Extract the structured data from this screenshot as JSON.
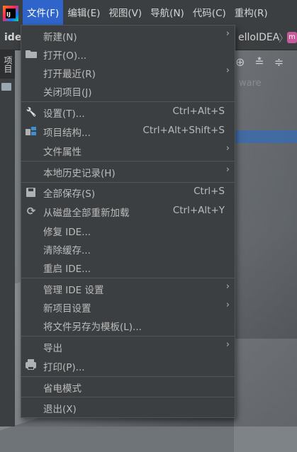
{
  "menubar": {
    "logo_text": "IJ",
    "items": [
      "文件(F)",
      "编辑(E)",
      "视图(V)",
      "导航(N)",
      "代码(C)",
      "重构(R)"
    ]
  },
  "navbar": {
    "project_name": "ide",
    "file_name": "elloIDEA",
    "chevron": "〉",
    "file_badge": "m"
  },
  "toolstrip": {
    "project_tab": "项目"
  },
  "background_text": {
    "ware": "ware"
  },
  "toolbar_icons": [
    "⊕",
    "≛",
    "≑"
  ],
  "menu": {
    "items": [
      {
        "label": "新建(N)",
        "shortcut": "",
        "submenu": true,
        "icon": ""
      },
      {
        "label": "打开(O)...",
        "shortcut": "",
        "submenu": false,
        "icon": "folder-open-icon"
      },
      {
        "label": "打开最近(R)",
        "shortcut": "",
        "submenu": true,
        "icon": ""
      },
      {
        "label": "关闭项目(J)",
        "shortcut": "",
        "submenu": false,
        "icon": ""
      },
      {
        "label": "设置(T)...",
        "shortcut": "Ctrl+Alt+S",
        "submenu": false,
        "icon": "wrench-icon"
      },
      {
        "label": "项目结构...",
        "shortcut": "Ctrl+Alt+Shift+S",
        "submenu": false,
        "icon": "project-structure-icon"
      },
      {
        "label": "文件属性",
        "shortcut": "",
        "submenu": true,
        "icon": ""
      },
      {
        "label": "本地历史记录(H)",
        "shortcut": "",
        "submenu": true,
        "icon": ""
      },
      {
        "label": "全部保存(S)",
        "shortcut": "Ctrl+S",
        "submenu": false,
        "icon": "save-icon"
      },
      {
        "label": "从磁盘全部重新加载",
        "shortcut": "Ctrl+Alt+Y",
        "submenu": false,
        "icon": "reload-icon"
      },
      {
        "label": "修复 IDE...",
        "shortcut": "",
        "submenu": false,
        "icon": ""
      },
      {
        "label": "清除缓存...",
        "shortcut": "",
        "submenu": false,
        "icon": ""
      },
      {
        "label": "重启 IDE...",
        "shortcut": "",
        "submenu": false,
        "icon": ""
      },
      {
        "label": "管理 IDE 设置",
        "shortcut": "",
        "submenu": true,
        "icon": ""
      },
      {
        "label": "新项目设置",
        "shortcut": "",
        "submenu": true,
        "icon": ""
      },
      {
        "label": "将文件另存为模板(L)...",
        "shortcut": "",
        "submenu": false,
        "icon": ""
      },
      {
        "label": "导出",
        "shortcut": "",
        "submenu": true,
        "icon": ""
      },
      {
        "label": "打印(P)...",
        "shortcut": "",
        "submenu": false,
        "icon": "printer-icon"
      },
      {
        "label": "省电模式",
        "shortcut": "",
        "submenu": false,
        "icon": ""
      },
      {
        "label": "退出(X)",
        "shortcut": "",
        "submenu": false,
        "icon": ""
      }
    ],
    "submenu_glyph": "›",
    "reload_glyph": "⟳",
    "wrench_glyph": "🔧"
  },
  "colors": {
    "menubar_bg": "#3c3f41",
    "active_menu_bg": "#2f65ca",
    "dropdown_bg": "#3c3f41",
    "separator": "#515658",
    "text": "#bbbbbb"
  }
}
